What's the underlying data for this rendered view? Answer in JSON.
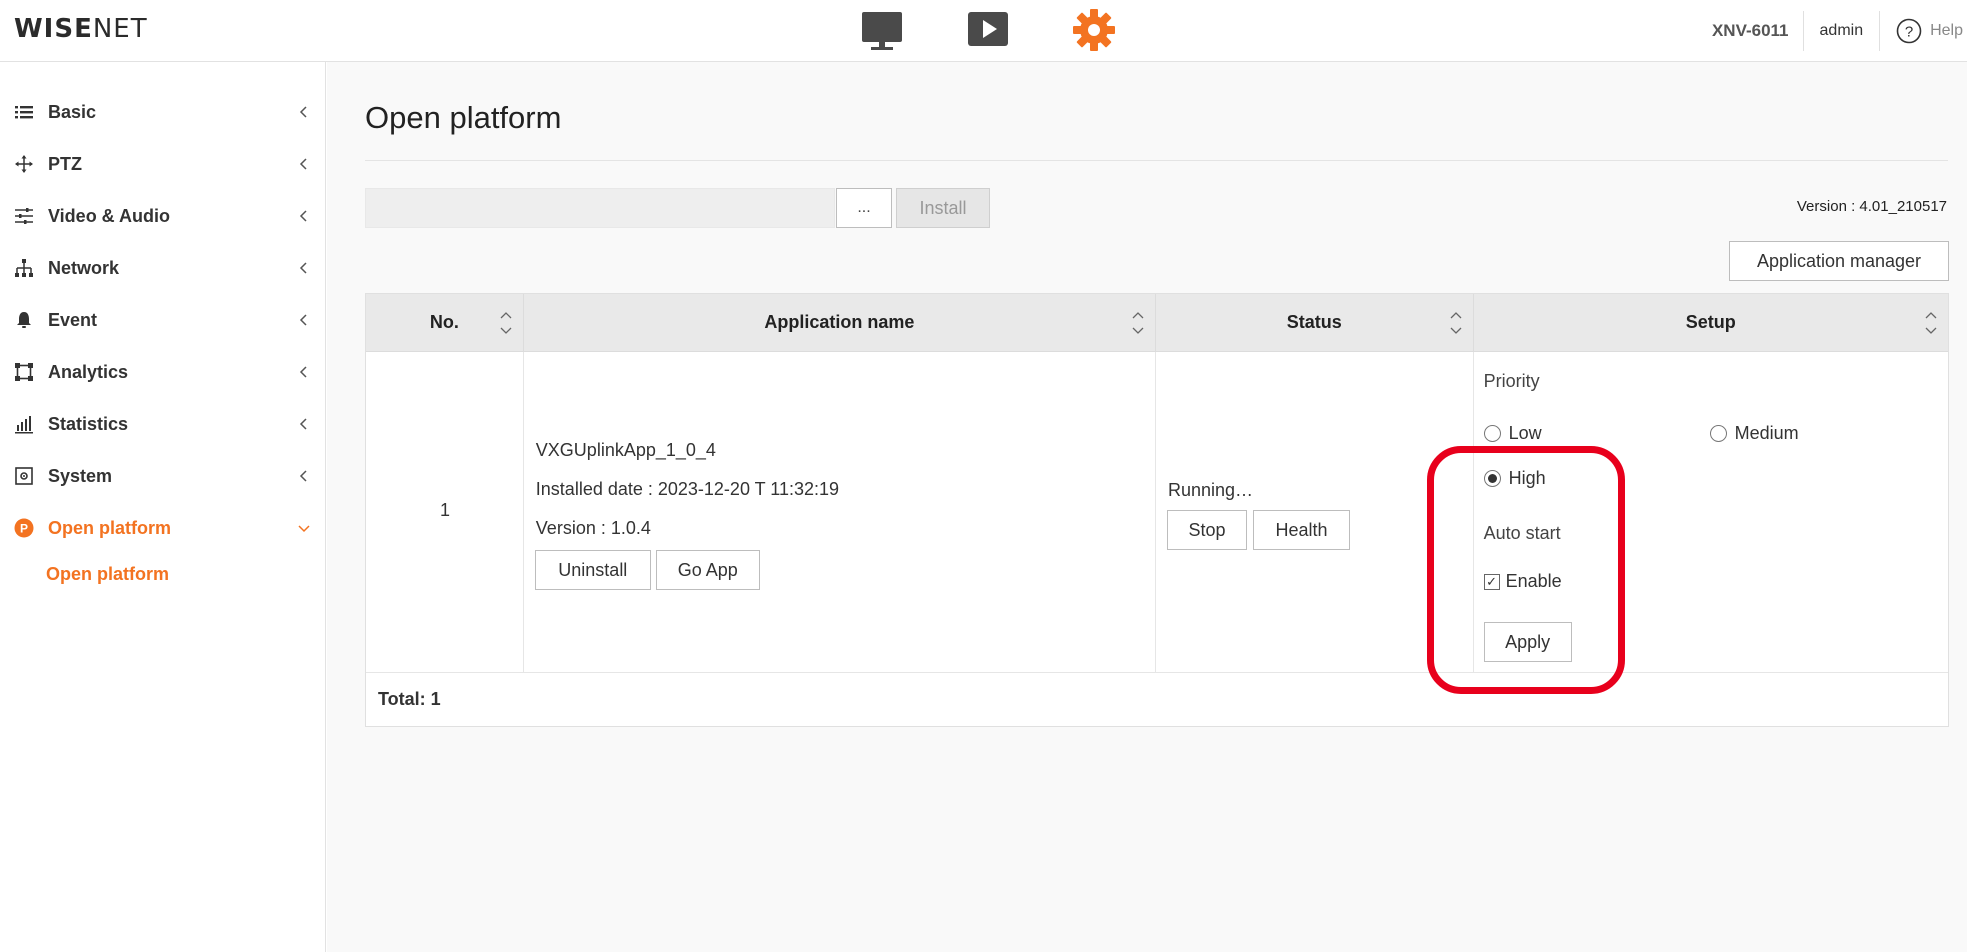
{
  "header": {
    "logo_bold": "WISE",
    "logo_light": "NET",
    "model": "XNV-6011",
    "user": "admin",
    "help_label": "Help",
    "top_icons": [
      "monitor-icon",
      "play-icon",
      "gear-icon"
    ],
    "accent_color": "#f37321"
  },
  "sidebar": {
    "items": [
      {
        "label": "Basic",
        "icon": "list-icon"
      },
      {
        "label": "PTZ",
        "icon": "move-icon"
      },
      {
        "label": "Video & Audio",
        "icon": "sliders-icon"
      },
      {
        "label": "Network",
        "icon": "network-icon"
      },
      {
        "label": "Event",
        "icon": "bell-icon"
      },
      {
        "label": "Analytics",
        "icon": "analytics-icon"
      },
      {
        "label": "Statistics",
        "icon": "bar-chart-icon"
      },
      {
        "label": "System",
        "icon": "system-icon"
      },
      {
        "label": "Open platform",
        "icon": "open-platform-icon",
        "active": true
      }
    ],
    "sub_items": [
      {
        "label": "Open platform",
        "active": true
      }
    ]
  },
  "main": {
    "title": "Open platform",
    "browse_label": "...",
    "install_label": "Install",
    "version": "Version : 4.01_210517",
    "app_manager_label": "Application manager",
    "table": {
      "headers": [
        "No.",
        "Application name",
        "Status",
        "Setup"
      ],
      "row": {
        "no": "1",
        "app_name": "VXGUplinkApp_1_0_4",
        "installed_date": "Installed date : 2023-12-20 T 11:32:19",
        "app_version": "Version : 1.0.4",
        "uninstall_label": "Uninstall",
        "goapp_label": "Go App",
        "status": "Running…",
        "stop_label": "Stop",
        "health_label": "Health",
        "priority_label": "Priority",
        "priority_options": [
          "Low",
          "Medium",
          "High"
        ],
        "priority_selected": "High",
        "autostart_label": "Auto start",
        "enable_label": "Enable",
        "enable_checked": true,
        "apply_label": "Apply"
      },
      "total": "Total: 1"
    }
  },
  "annotation": {
    "highlight_color": "#e8001c"
  }
}
